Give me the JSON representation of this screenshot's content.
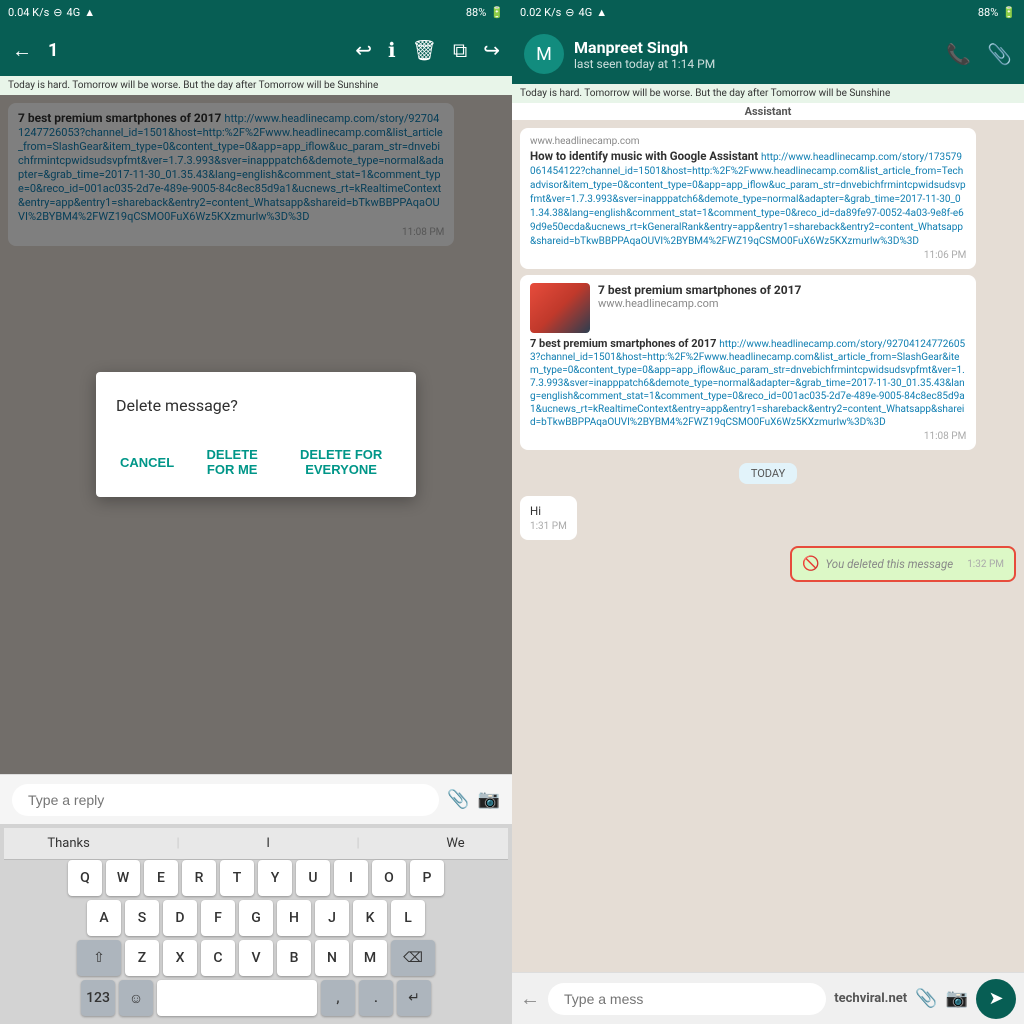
{
  "left": {
    "status": {
      "speed": "0.04 K/s",
      "battery": "88%",
      "signal": "4G"
    },
    "toolbar": {
      "count": "1",
      "icons": [
        "reply",
        "info",
        "delete",
        "copy",
        "forward"
      ]
    },
    "marquee": "Today is hard. Tomorrow will be worse. But the day after Tomorrow will be Sunshine",
    "messages": [
      {
        "text": "7 best premium smartphones of 2017",
        "link": "http://www.headlinecamp.com/story/927041247726053?channel_id=1501&host=http:%2F%2Fwww.headlinecamp.com&list_article_from=SlashGear&item_type=0&content_type=0&app=app_iflow&uc_param_str=dnvebichfrmintcpwidsudsvpfmt&ver=1.7.3.993&sver=inapppatch6&demote_type=normal&adapter=&grab_time=2017-11-30_01.35.43&lang=english&comment_stat=1&comment_type=0&reco_id=001ac035-2d7e-489e-9005-84c8ec85d9a1&ucnews_rt=kRealtimeContext&entry=app&entry1=shareback&entry2=content_Whatsapp&shareid=bTkwBBPPAqaOUVI%2BYBM4%2FWZ19qCSMO0FuX6Wz5KXzmurlw%3D%3D",
        "time": "11:08 PM"
      }
    ],
    "dialog": {
      "title": "Delete message?",
      "cancel": "CANCEL",
      "delete_for_me": "DELETE FOR ME",
      "delete_for_everyone": "DELETE FOR EVERYONE"
    },
    "reply_placeholder": "Type a reply",
    "keyboard": {
      "suggestions": [
        "Thanks",
        "I",
        "We"
      ],
      "rows": [
        [
          "Q",
          "W",
          "E",
          "R",
          "T",
          "Y",
          "U",
          "I",
          "O",
          "P"
        ],
        [
          "A",
          "S",
          "D",
          "F",
          "G",
          "H",
          "J",
          "K",
          "L"
        ],
        [
          "⇧",
          "Z",
          "X",
          "C",
          "V",
          "B",
          "N",
          "M",
          "⌫"
        ],
        [
          "123",
          "☺",
          "",
          "",
          "",
          "",
          "",
          "",
          ",",
          ".",
          "↵"
        ]
      ]
    }
  },
  "right": {
    "status": {
      "speed": "0.02 K/s",
      "battery": "88%",
      "signal": "4G"
    },
    "contact": {
      "name": "Manpreet Singh",
      "status": "last seen today at 1:14 PM",
      "avatar_initial": "M"
    },
    "toolbar_icons": [
      "phone",
      "paperclip"
    ],
    "marquee": "Today is hard. Tomorrow will be worse. But the day after Tomorrow will be Sunshine",
    "assistant_label": "Assistant",
    "messages": [
      {
        "type": "received",
        "thumbnail_title": "7 best premium smartphones of 2017",
        "thumbnail_url": "www.headlinecamp.com",
        "assistant_label": "Assistant",
        "text": "How to identify music with Google Assistant",
        "link": "http://www.headlinecamp.com/story/173579061454122?channel_id=1501&host=http:%2F%2Fwww.headlinecamp.com&list_article_from=Techadvisor&item_type=0&content_type=0&app=app_iflow&uc_param_str=dnvebichfrmintcpwidsudsvpfmt&ver=1.7.3.993&sver=inapppatch6&demote_type=normal&adapter=&grab_time=2017-11-30_01.34.38&lang=english&comment_stat=1&comment_type=0&reco_id=da89fe97-0052-4a03-9e8f-e69d9e50ecda&ucnews_rt=kGeneralRank&entry=app&entry1=shareback&entry2=content_Whatsapp&shareid=bTkwBBPPAqaOUVI%2BYBM4%2FWZ19qCSMO0FuX6Wz5KXzmurlw%3D%3D",
        "time": "11:06 PM"
      },
      {
        "type": "received",
        "has_thumbnail": true,
        "thumbnail_title": "7 best premium smartphones of 2017",
        "thumbnail_url": "www.headlinecamp.com",
        "body_text": "7 best premium smartphones of 2017",
        "body_link": "http://www.headlinecamp.com/story/927041247726053?channel_id=1501&host=http:%2F%2Fwww.headlinecamp.com&list_article_from=SlashGear&item_type=0&content_type=0&app=app_iflow&uc_param_str=dnvebichfrmintcpwidsudsvpfmt&ver=1.7.3.993&sver=inapppatch6&demote_type=normal&adapter=&grab_time=2017-11-30_01.35.43&lang=english&comment_stat=1&comment_type=0&reco_id=001ac035-2d7e-489e-9005-84c8ec85d9a1&ucnews_rt=kRealtimeContext&entry=app&entry1=shareback&entry2=content_Whatsapp&shareid=bTkwBBPPAqaOUVI%2BYBM4%2FWZ19qCSMO0FuX6Wz5KXzmurlw%3D%3D",
        "time": "11:08 PM"
      }
    ],
    "today_label": "TODAY",
    "recent_messages": [
      {
        "type": "received",
        "text": "Hi",
        "time": "1:31 PM"
      },
      {
        "type": "sent_deleted",
        "text": "You deleted this message",
        "time": "1:32 PM"
      }
    ],
    "input_placeholder": "Type a mess",
    "watermark": "techviral.net"
  }
}
